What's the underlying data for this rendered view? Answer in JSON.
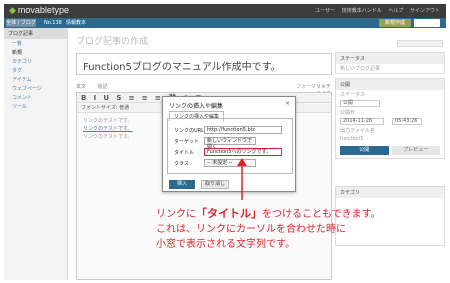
{
  "app": {
    "logo_text": "movabletype",
    "user_links": [
      "ユーザー",
      "技術教本ハンドル",
      "ヘルプ",
      "サインアウト"
    ]
  },
  "subbar": {
    "blog_button": "全体 / ブログ",
    "blog_id": "No.138",
    "blog_name": "情報教本",
    "new_button": "新規作成"
  },
  "sidebar": {
    "head": "ブログ記事",
    "items": [
      "一覧",
      "新規",
      "カテゴリ",
      "タグ",
      "アイテム",
      "ウェブページ",
      "コメント",
      "ツール"
    ]
  },
  "main": {
    "page_title": "ブログ記事の作成",
    "title_value": "Function5ブログのマニュアル作成中です。",
    "toolbar_labels": [
      "本文",
      "追記"
    ],
    "format_label": "フォーマット",
    "format_value": "リッチテキスト",
    "toolbar_buttons": [
      "B",
      "I",
      "U",
      "S",
      "≡",
      "≡",
      "≡",
      "⛓",
      "❝",
      "⊞"
    ],
    "font_label": "フォントサイズ: 普通",
    "body_lines": [
      "リンクのテストです。",
      "リンクのテストです。",
      "リンクのテストです。"
    ],
    "link_text": "リンクのテストです。"
  },
  "rpanel": {
    "status_head": "ステータス",
    "status_value": "新しいブログ記事",
    "publish_head": "公開",
    "state_label": "ステータス",
    "state_value": "公開",
    "date_label": "公開日",
    "date_value": "2014-11-28",
    "time_value": "05:43:26",
    "filename_label": "出力ファイル名",
    "filename_value": "function5",
    "publish_button": "公開",
    "preview_button": "プレビュー",
    "category_head": "カテゴリ"
  },
  "dialog": {
    "title": "リンクの挿入や編集",
    "close": "×",
    "tab": "リンクの挿入や編集",
    "url_label": "リンクのURL",
    "url_value": "http://function5.biz",
    "target_label": "ターゲット",
    "target_value": "新しいウィンドウで開く",
    "title_label": "タイトル",
    "title_value": "Function5へのリンクです。",
    "class_label": "クラス",
    "class_value": "-- 未設定 --",
    "insert_button": "挿入",
    "cancel_button": "取り消し"
  },
  "annotation": {
    "line1_pre": "リンクに",
    "line1_em": "「タイトル」",
    "line1_post": "をつけることもできます。",
    "line2": "これは、リンクにカーソルを合わせた時に",
    "line3": "小窓で表示される文字列です。"
  },
  "colors": {
    "accent": "#2b6a8f",
    "annotation": "#e0212a"
  }
}
